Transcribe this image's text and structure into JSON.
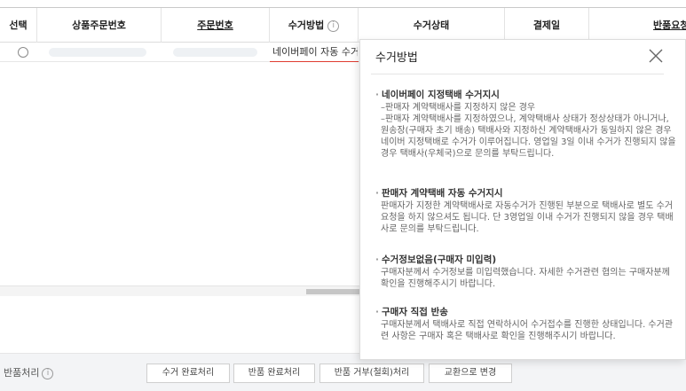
{
  "table": {
    "columns": [
      "선택",
      "상품주문번호",
      "주문번호",
      "수거방법",
      "수거상태",
      "결제일",
      "반품요청"
    ],
    "row": {
      "method": "네이버페이 자동 수거지시",
      "tail": "3"
    }
  },
  "popup": {
    "title": "수거방법",
    "sections": [
      {
        "title": "네이버페이 지정택배 수거지시",
        "body": "–판매자 계약택배사를 지정하지 않은 경우\n–판매자 계약택배사를 지정하였으나, 계약택배사 상태가 정상상태가 아니거나, 원송장(구매자 초기 배송) 택배사와 지정하신 계약택배사가 동일하지 않은 경우 네이버 지정택배로 수거가 이루어집니다. 영업일 3일 이내 수거가 진행되지 않을 경우 택배사(우체국)으로 문의를 부탁드립니다."
      },
      {
        "title": "판매자 계약택배 자동 수거지시",
        "body": "판매자가 지정한 계약택배사로 자동수거가 진행된 부분으로 택배사로 별도 수거요청을 하지 않으셔도 됩니다. 단 3영업일 이내 수거가 진행되지 않을 경우 택배사로 문의를 부탁드립니다."
      },
      {
        "title": "수거정보없음(구매자 미입력)",
        "body": "구매자분께서 수거정보를 미입력했습니다. 자세한 수거관련 협의는 구매자분께 확인을 진행해주시기 바랍니다."
      },
      {
        "title": "구매자 직접 반송",
        "body": "구매자분께서 택배사로 직접 연락하시어 수거접수를 진행한 상태입니다. 수거관련 사항은 구매자 혹은 택배사로 확인을 진행해주시기 바랍니다."
      }
    ]
  },
  "bottom": {
    "label": "반품처리",
    "buttons": [
      "수거 완료처리",
      "반품 완료처리",
      "반품 거부(철회)처리",
      "교환으로 변경"
    ]
  },
  "colors": {
    "accent_underline": "#e03c31",
    "bottom_bg": "#f3f4f6"
  },
  "icons": {
    "info": "info-circle-icon",
    "close": "close-icon"
  }
}
